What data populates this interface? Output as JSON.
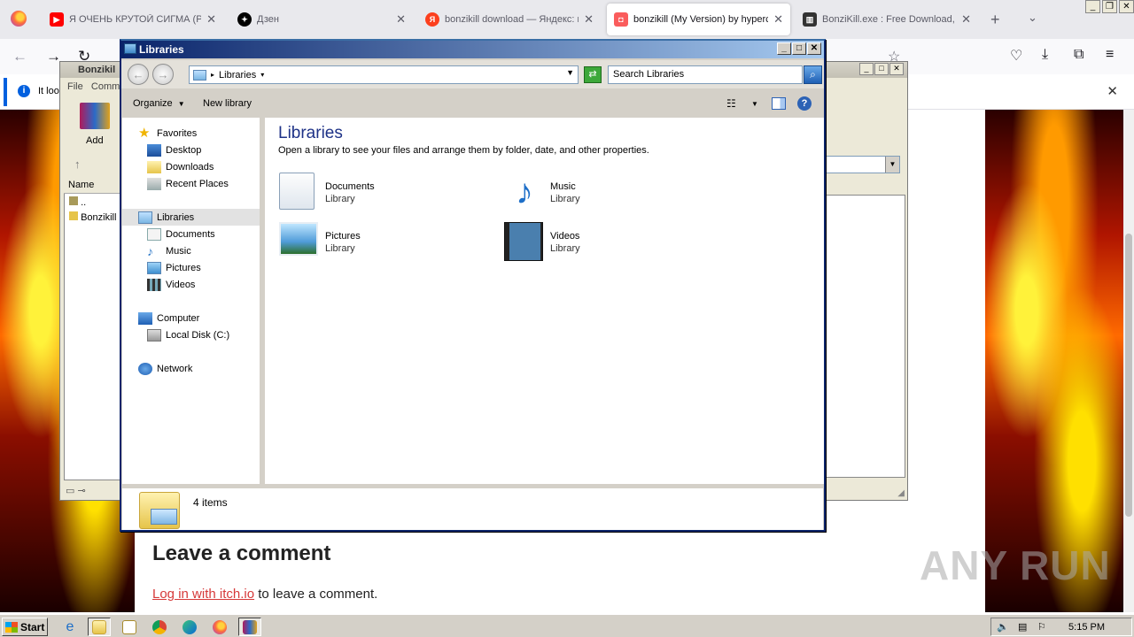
{
  "browser": {
    "tabs": [
      {
        "title": "Я ОЧЕНЬ КРУТОЙ СИГМА (PHONK",
        "favicon": "youtube-icon",
        "color": "#ff0000"
      },
      {
        "title": "Дзен",
        "favicon": "dzen-icon",
        "color": "#000000"
      },
      {
        "title": "bonzikill download — Яндекс: на",
        "favicon": "yandex-icon",
        "color": "#fc3f1d"
      },
      {
        "title": "bonzikill (My Version) by hyperc",
        "favicon": "itch-icon",
        "color": "#fa5c5c"
      },
      {
        "title": "BonziKill.exe : Free Download, B",
        "favicon": "archive-icon",
        "color": "#333333"
      }
    ],
    "notification_text": "It loo"
  },
  "page": {
    "comment_title": "Leave a comment",
    "login_link": "Log in with itch.io",
    "comment_suffix": " to leave a comment.",
    "watermark": "ANY RUN"
  },
  "rar": {
    "title": "Bonzikil",
    "menu_file": "File",
    "menu_comm": "Comm",
    "add_label": "Add",
    "col_name": "Name",
    "row_up": "..",
    "row_file": "Bonzikill"
  },
  "explorer": {
    "title": "Libraries",
    "address": "Libraries",
    "search_placeholder": "Search Libraries",
    "organize": "Organize",
    "new_library": "New library",
    "nav": {
      "favorites": "Favorites",
      "desktop": "Desktop",
      "downloads": "Downloads",
      "recent": "Recent Places",
      "libraries": "Libraries",
      "documents": "Documents",
      "music": "Music",
      "pictures": "Pictures",
      "videos": "Videos",
      "computer": "Computer",
      "local_disk": "Local Disk (C:)",
      "network": "Network"
    },
    "heading": "Libraries",
    "subheading": "Open a library to see your files and arrange them by folder, date, and other properties.",
    "libraries": [
      {
        "name": "Documents",
        "kind": "Library"
      },
      {
        "name": "Music",
        "kind": "Library"
      },
      {
        "name": "Pictures",
        "kind": "Library"
      },
      {
        "name": "Videos",
        "kind": "Library"
      }
    ],
    "status_count": "4 items"
  },
  "taskbar": {
    "start_label": "Start",
    "clock": "5:15 PM"
  }
}
